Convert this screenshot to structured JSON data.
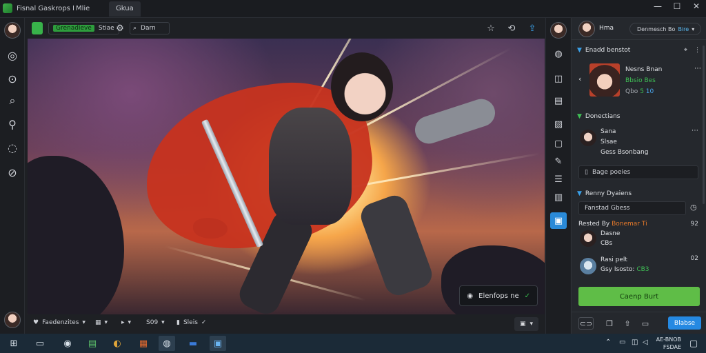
{
  "window": {
    "title": "Fisnal Gaskrops I",
    "tabs": [
      "Mlie",
      "Gkua"
    ],
    "controls": [
      "—",
      "☐",
      "✕"
    ]
  },
  "toolbar": {
    "model_tag": "Grenadieve",
    "model_label": "Stiae",
    "search_label": "Darn"
  },
  "canvas": {
    "badge_label": "Elenfops ne",
    "badge_check": "✓"
  },
  "bottom_bar": {
    "item1": "Faedenzites",
    "item2": "S09",
    "item3": "Sleis"
  },
  "panel": {
    "user_name": "Hma",
    "pill_prefix": "Denmesch Bo",
    "pill_accent": "Bire",
    "section1": {
      "title": "Enadd benstot",
      "card_name": "Nesns Bnan",
      "card_line2": "Bbsio Bes",
      "card_line3_a": "Qbo",
      "card_line3_b": "5",
      "card_line3_c": "10"
    },
    "section2": {
      "title": "Donectians",
      "row_name": "Sana",
      "row_sub": "Slsae",
      "row_sub2": "Gess Bsonbang",
      "field_label": "Bage poeies"
    },
    "section3": {
      "title": "Renny Dyaiens",
      "field_label": "Fanstad Gbess",
      "row1_title_a": "Rested By",
      "row1_title_b": "Bonemar",
      "row1_title_c": "Ti",
      "row1_right": "92",
      "row2_name": "Dasne",
      "row2_sub": "CBs",
      "row3_name": "Rasi pelt",
      "row3_sub_a": "Gsy Isosto:",
      "row3_sub_b": "CB3",
      "row3_right": "02"
    },
    "primary_button": "Caenp Burt",
    "secondary_button": "Blabse"
  },
  "taskbar": {
    "clock_line1": "AE-BNOB",
    "clock_line2": "FSDAE"
  },
  "colors": {
    "accent_green": "#5fbd47",
    "accent_blue": "#2589e2",
    "window_bg": "#1e2024"
  }
}
